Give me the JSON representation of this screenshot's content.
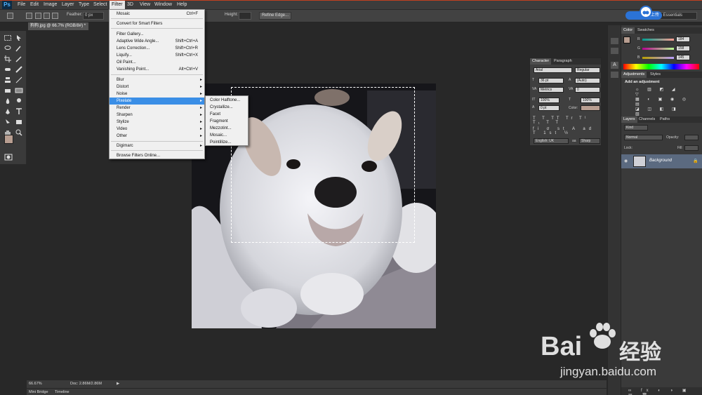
{
  "menubar": {
    "logo": "Ps",
    "items": [
      "File",
      "Edit",
      "Image",
      "Layer",
      "Type",
      "Select",
      "Filter",
      "3D",
      "View",
      "Window",
      "Help"
    ],
    "active": "Filter"
  },
  "optbar": {
    "feather_label": "Feather:",
    "feather_value": "0 px",
    "height_label": "Height:",
    "refine_edge": "Refine Edge...",
    "workspace": "Essentials"
  },
  "baidu_button": "拍摄上传",
  "document": {
    "tab_title": "狗狗.jpg @ 66.7% (RGB/8#) *",
    "zoom": "66.67%",
    "doc_info": "Doc: 2.86M/2.86M"
  },
  "bottom_tabs": [
    "Mini Bridge",
    "Timeline"
  ],
  "filter_menu": {
    "items": [
      {
        "label": "Mosaic",
        "shortcut": "Ctrl+F"
      },
      {
        "label": "Convert for Smart Filters",
        "shortcut": ""
      },
      {
        "label": "Filter Gallery...",
        "shortcut": ""
      },
      {
        "label": "Adaptive Wide Angle...",
        "shortcut": "Shift+Ctrl+A"
      },
      {
        "label": "Lens Correction...",
        "shortcut": "Shift+Ctrl+R"
      },
      {
        "label": "Liquify...",
        "shortcut": "Shift+Ctrl+X"
      },
      {
        "label": "Oil Paint...",
        "shortcut": ""
      },
      {
        "label": "Vanishing Point...",
        "shortcut": "Alt+Ctrl+V"
      },
      {
        "label": "Blur",
        "shortcut": ""
      },
      {
        "label": "Distort",
        "shortcut": ""
      },
      {
        "label": "Noise",
        "shortcut": ""
      },
      {
        "label": "Pixelate",
        "shortcut": ""
      },
      {
        "label": "Render",
        "shortcut": ""
      },
      {
        "label": "Sharpen",
        "shortcut": ""
      },
      {
        "label": "Stylize",
        "shortcut": ""
      },
      {
        "label": "Video",
        "shortcut": ""
      },
      {
        "label": "Other",
        "shortcut": ""
      },
      {
        "label": "Digimarc",
        "shortcut": ""
      },
      {
        "label": "Browse Filters Online...",
        "shortcut": ""
      }
    ],
    "highlighted": "Pixelate"
  },
  "pixelate_submenu": {
    "items": [
      "Color Halftone...",
      "Crystallize...",
      "Facet",
      "Fragment",
      "Mezzotint...",
      "Mosaic...",
      "Pointillize..."
    ]
  },
  "color_panel": {
    "tabs": [
      "Color",
      "Swatches"
    ],
    "r": "184",
    "g": "158",
    "b": "145",
    "r_label": "R",
    "g_label": "G",
    "b_label": "B",
    "foreground": "#b89e91"
  },
  "adjustments_panel": {
    "tabs": [
      "Adjustments",
      "Styles"
    ],
    "heading": "Add an adjustment"
  },
  "layers_panel": {
    "tabs": [
      "Layers",
      "Channels",
      "Paths"
    ],
    "kind": "Kind",
    "blend_mode": "Normal",
    "opacity_label": "Opacity:",
    "lock_label": "Lock:",
    "fill_label": "Fill:",
    "layer_name": "Background"
  },
  "character_panel": {
    "tabs": [
      "Character",
      "Paragraph"
    ],
    "font_family": "Arial",
    "font_style": "Regular",
    "size": "36 pt",
    "leading": "(Auto)",
    "kerning": "Metrics",
    "tracking": "0",
    "vscale": "100%",
    "hscale": "100%",
    "baseline": "0 pt",
    "color_label": "Color:",
    "language": "English: UK",
    "aa_label": "aa",
    "antialias": "Sharp"
  },
  "watermark": {
    "brand": "Bai",
    "brand_cn": "经验",
    "url": "jingyan.baidu.com"
  }
}
